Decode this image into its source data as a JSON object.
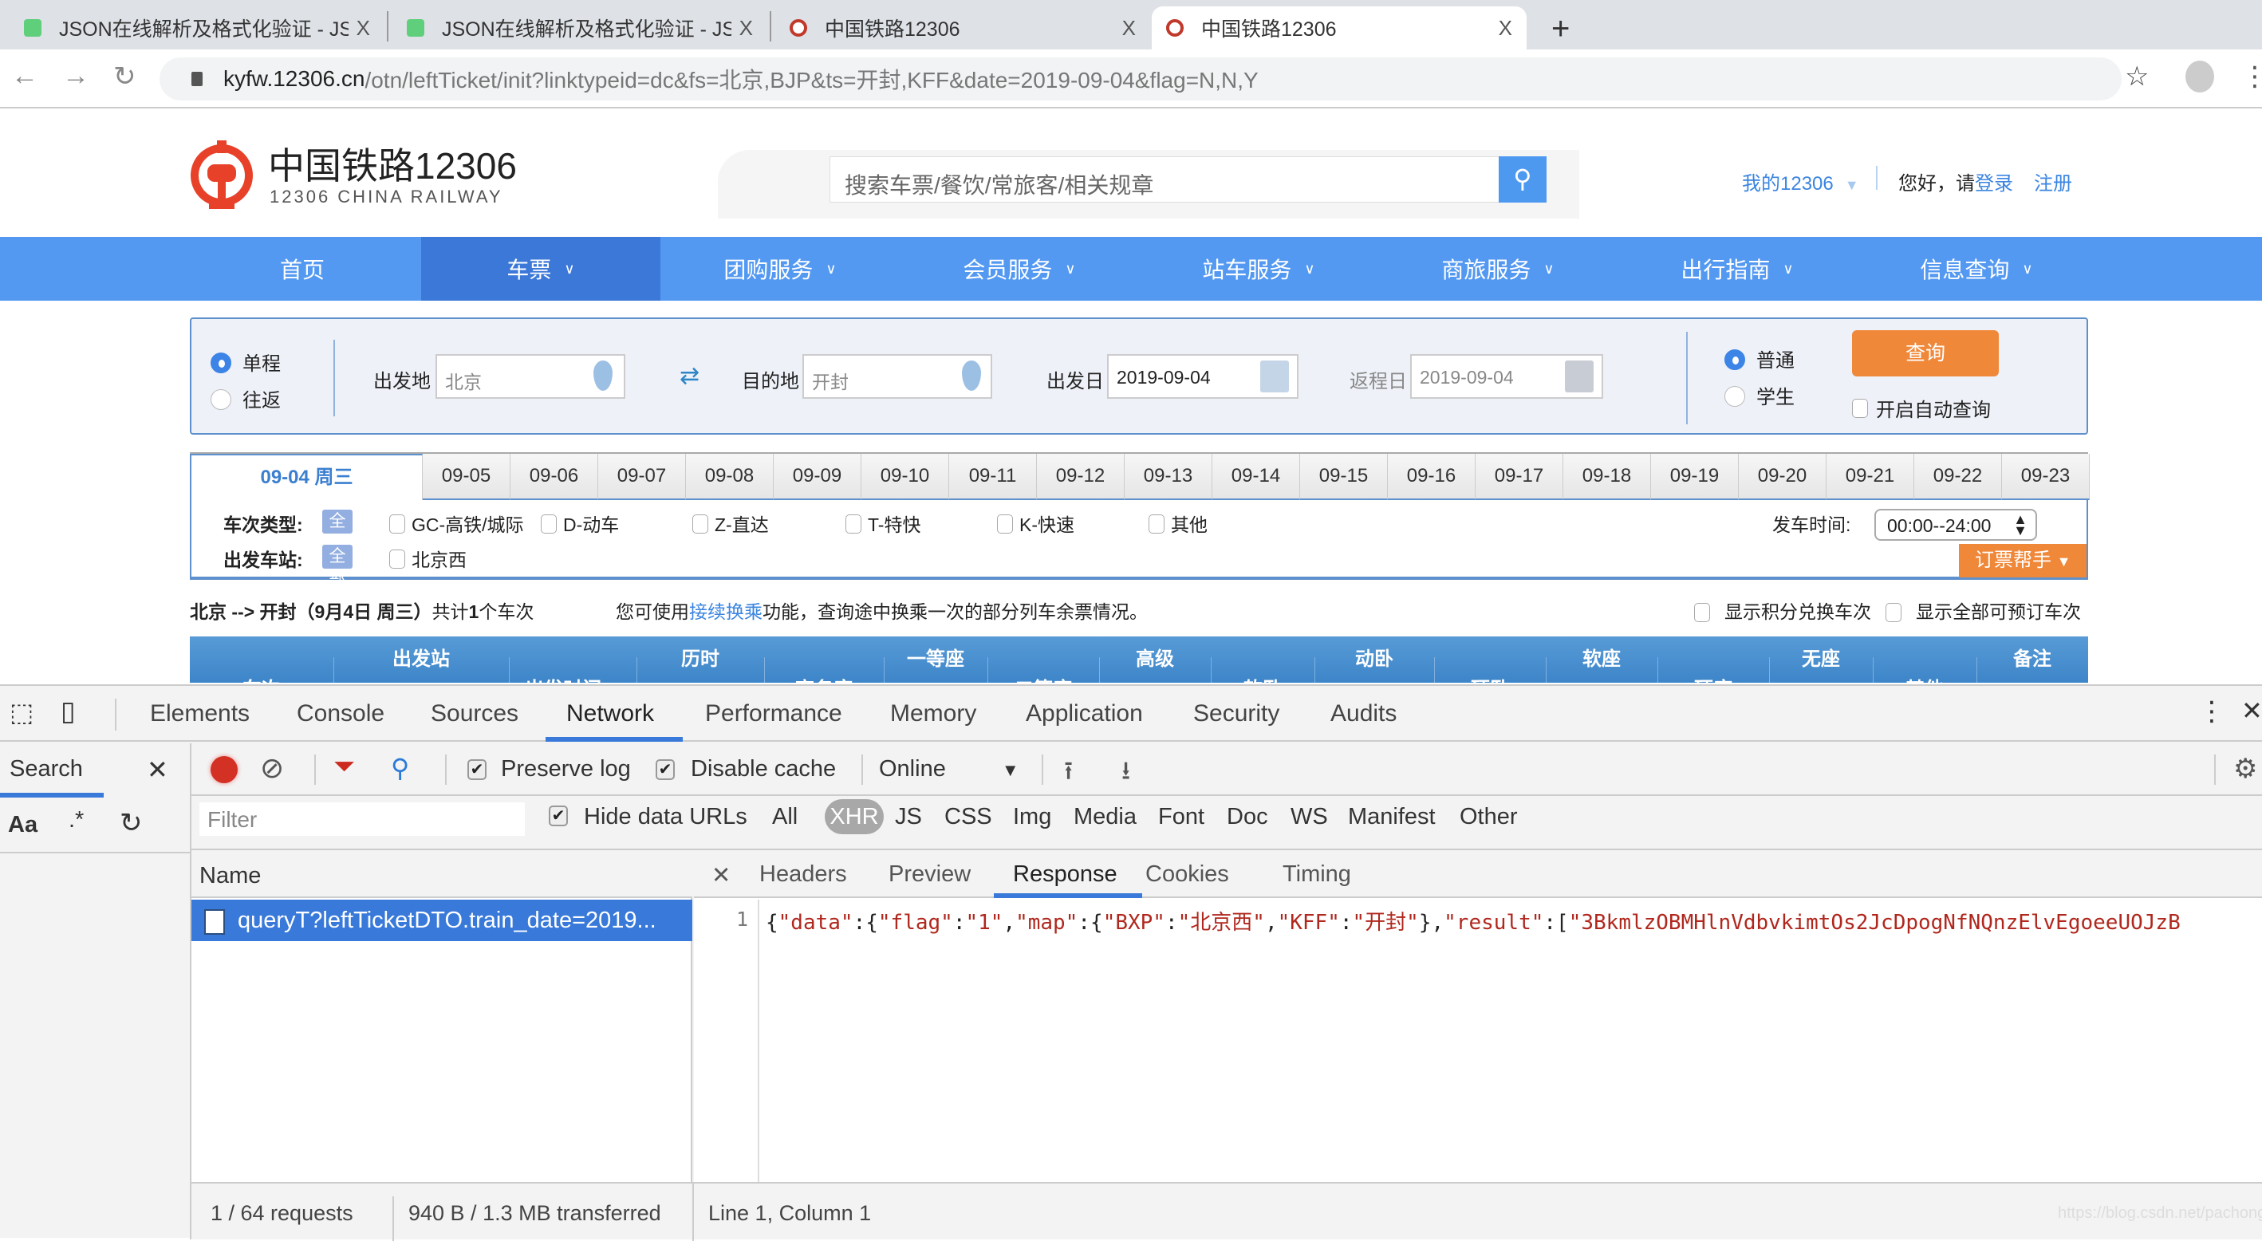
{
  "browser": {
    "tabs": [
      {
        "title": "JSON在线解析及格式化验证 - JSON",
        "icon": "json-favicon"
      },
      {
        "title": "JSON在线解析及格式化验证 - JSON",
        "icon": "json-favicon"
      },
      {
        "title": "中国铁路12306",
        "icon": "railway-favicon"
      },
      {
        "title": "中国铁路12306",
        "icon": "railway-favicon",
        "active": true
      }
    ],
    "close_glyph": "X",
    "new_tab_glyph": "+",
    "url_host": "kyfw.12306.cn",
    "url_path": "/otn/leftTicket/init?linktypeid=dc&fs=北京,BJP&ts=开封,KFF&date=2019-09-04&flag=N,N,Y"
  },
  "site": {
    "brand": "中国铁路12306",
    "brand_sub": "12306 CHINA RAILWAY",
    "search_placeholder": "搜索车票/餐饮/常旅客/相关规章",
    "my12306": "我的12306",
    "greeting": "您好，请",
    "login": "登录",
    "register": "注册",
    "nav": [
      {
        "label": "首页",
        "dropdown": false
      },
      {
        "label": "车票",
        "dropdown": true,
        "active": true
      },
      {
        "label": "团购服务",
        "dropdown": true
      },
      {
        "label": "会员服务",
        "dropdown": true
      },
      {
        "label": "站车服务",
        "dropdown": true
      },
      {
        "label": "商旅服务",
        "dropdown": true
      },
      {
        "label": "出行指南",
        "dropdown": true
      },
      {
        "label": "信息查询",
        "dropdown": true
      }
    ]
  },
  "query": {
    "trip_types": [
      {
        "label": "单程",
        "selected": true
      },
      {
        "label": "往返",
        "selected": false
      }
    ],
    "from_label": "出发地",
    "from_value": "北京",
    "to_label": "目的地",
    "to_value": "开封",
    "depart_label": "出发日",
    "depart_value": "2019-09-04",
    "return_label": "返程日",
    "return_value": "2019-09-04",
    "passenger_types": [
      {
        "label": "普通",
        "selected": true
      },
      {
        "label": "学生",
        "selected": false
      }
    ],
    "query_button": "查询",
    "auto_query_label": "开启自动查询"
  },
  "dates": {
    "active": "09-04 周三",
    "others": [
      "09-05",
      "09-06",
      "09-07",
      "09-08",
      "09-09",
      "09-10",
      "09-11",
      "09-12",
      "09-13",
      "09-14",
      "09-15",
      "09-16",
      "09-17",
      "09-18",
      "09-19",
      "09-20",
      "09-21",
      "09-22",
      "09-23"
    ]
  },
  "filters": {
    "train_type_label": "车次类型:",
    "station_label": "出发车站:",
    "all_label": "全部",
    "train_types": [
      "GC-高铁/城际",
      "D-动车",
      "Z-直达",
      "T-特快",
      "K-快速",
      "其他"
    ],
    "stations": [
      "北京西"
    ],
    "time_label": "发车时间:",
    "time_value": "00:00--24:00",
    "helper_button": "订票帮手"
  },
  "summary": {
    "route": "北京 --> 开封（9月4日  周三）",
    "count_prefix": "共计",
    "count": "1",
    "count_suffix": "个车次",
    "hint_prefix": "您可使用",
    "hint_link": "接续换乘",
    "hint_suffix": "功能，查询途中换乘一次的部分列车余票情况。",
    "show_points": "显示积分兑换车次",
    "show_all": "显示全部可预订车次"
  },
  "table": {
    "headers": [
      "车次",
      "出发站",
      "出发时间▲",
      "历时",
      "商务座",
      "一等座",
      "二等座",
      "高级",
      "软卧",
      "动卧",
      "硬卧",
      "软座",
      "硬座",
      "无座",
      "其他",
      "备注"
    ]
  },
  "devtools": {
    "tabs": [
      "Elements",
      "Console",
      "Sources",
      "Network",
      "Performance",
      "Memory",
      "Application",
      "Security",
      "Audits"
    ],
    "active_tab": "Network",
    "search_label": "Search",
    "preserve_log": "Preserve log",
    "disable_cache": "Disable cache",
    "throttle": "Online",
    "filter_placeholder": "Filter",
    "hide_data_urls": "Hide data URLs",
    "type_filters": [
      "All",
      "XHR",
      "JS",
      "CSS",
      "Img",
      "Media",
      "Font",
      "Doc",
      "WS",
      "Manifest",
      "Other"
    ],
    "active_type": "XHR",
    "search_opts": [
      "Aa",
      ".*"
    ],
    "name_header": "Name",
    "request_name": "queryT?leftTicketDTO.train_date=2019...",
    "detail_tabs": [
      "Headers",
      "Preview",
      "Response",
      "Cookies",
      "Timing"
    ],
    "active_detail": "Response",
    "line_number": "1",
    "response_line": "{\"data\":{\"flag\":\"1\",\"map\":{\"BXP\":\"北京西\",\"KFF\":\"开封\"},\"result\":[\"3BkmlzOBMHlnVdbvkimtOs2JcDpogNfNQnzElvEgoeeUOJzB",
    "status_requests": "1 / 64 requests",
    "status_transferred": "940 B / 1.3 MB transferred",
    "status_cursor": "Line 1, Column 1"
  },
  "watermark": "https://blog.csdn.net/pachongpapa"
}
